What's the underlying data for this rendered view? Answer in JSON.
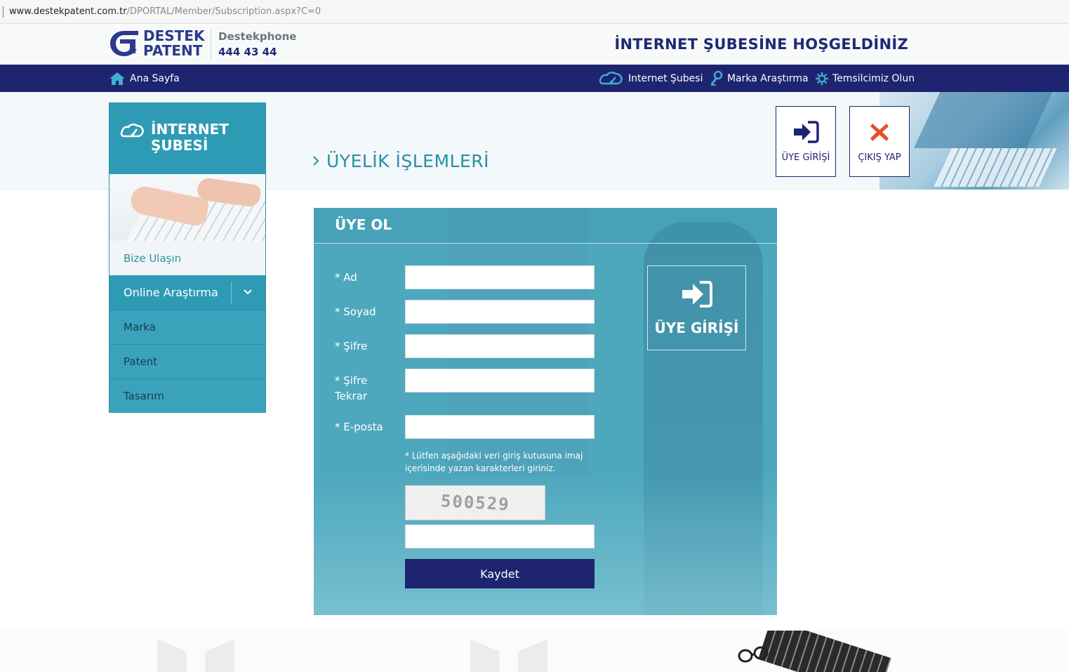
{
  "browser": {
    "url_host": "www.destekpatent.com.tr",
    "url_path": "/DPORTAL/Member/Subscription.aspx?C=0"
  },
  "header": {
    "logo_line1": "DESTEK",
    "logo_line2": "PATENT",
    "phone_label": "Destekphone",
    "phone_number": "444 43 44",
    "welcome": "İNTERNET ŞUBESİNE HOŞGELDİNİZ"
  },
  "nav": {
    "home": "Ana Sayfa",
    "items": [
      "Internet Şubesi",
      "Marka Araştırma",
      "Temsilcimiz Olun"
    ]
  },
  "page": {
    "title": "ÜYELİK İŞLEMLERİ",
    "login_button": "ÜYE GİRİŞİ",
    "logout_button": "ÇIKIŞ YAP"
  },
  "sidebar": {
    "title_line1": "İNTERNET",
    "title_line2": "ŞUBESİ",
    "contact": "Bize Ulaşın",
    "online": "Online Araştırma",
    "sub_items": [
      "Marka",
      "Patent",
      "Tasarım"
    ]
  },
  "form": {
    "title": "ÜYE OL",
    "fields": [
      {
        "label": "* Ad",
        "value": ""
      },
      {
        "label": "* Soyad",
        "value": ""
      },
      {
        "label": "* Şifre",
        "value": ""
      },
      {
        "label": "* Şifre Tekrar",
        "value": ""
      },
      {
        "label": "* E-posta",
        "value": ""
      }
    ],
    "captcha_note": "* Lütfen aşağıdaki veri giriş kutusuna imaj içerisinde yazan karakterleri giriniz.",
    "captcha_text": "500529",
    "captcha_value": "",
    "submit": "Kaydet",
    "login_box_label": "ÜYE GİRİŞİ"
  },
  "colors": {
    "navy": "#1f2470",
    "teal": "#2e9bb4",
    "logout_red": "#e8502a"
  },
  "icons": [
    "home-icon",
    "cloud-speed-icon",
    "search-person-icon",
    "gear-icon",
    "sign-in-icon",
    "close-x-icon",
    "chevron-down-icon",
    "chevron-right-icon"
  ]
}
